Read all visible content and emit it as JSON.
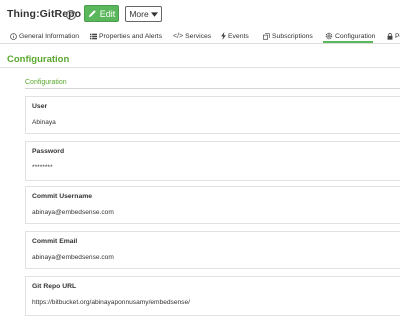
{
  "header": {
    "title": "Thing:GitRepo",
    "help_icon": "question-circle-icon",
    "edit_label": "Edit",
    "edit_icon": "pencil-icon",
    "more_label": "More",
    "more_icon": "caret-down-icon",
    "accent_color": "#5bb75b"
  },
  "tabs": [
    {
      "label": "General Information",
      "icon": "info-circle-icon"
    },
    {
      "label": "Properties and Alerts",
      "icon": "list-icon"
    },
    {
      "label": "Services",
      "icon": "code-icon"
    },
    {
      "label": "Events",
      "icon": "lightning-icon"
    },
    {
      "label": "Subscriptions",
      "icon": "subscriptions-icon"
    },
    {
      "label": "Configuration",
      "icon": "gear-icon",
      "active": true
    },
    {
      "label": "Pe",
      "icon": "lock-icon"
    }
  ],
  "page": {
    "section_title": "Configuration",
    "group_title": "Configuration"
  },
  "fields": [
    {
      "label": "User",
      "value": "Abinaya"
    },
    {
      "label": "Password",
      "value": "********"
    },
    {
      "label": "Commit Username",
      "value": "abinaya@embedsense.com"
    },
    {
      "label": "Commit Email",
      "value": "abinaya@embedsense.com"
    },
    {
      "label": "Git Repo URL",
      "value": "https://bitbucket.org/abinayaponnusamy/embedsense/"
    }
  ]
}
